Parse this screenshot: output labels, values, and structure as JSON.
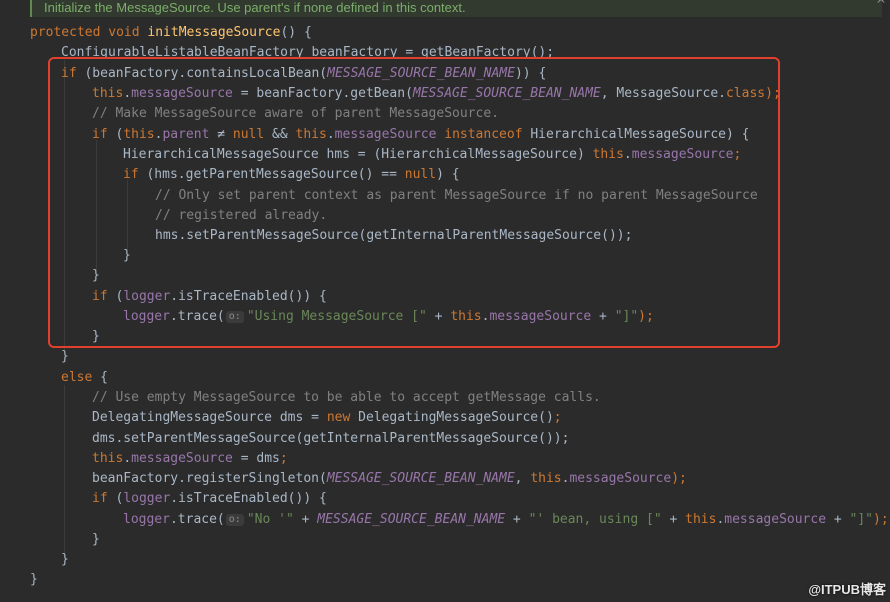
{
  "doc_comment": "Initialize the MessageSource. Use parent's if none defined in this context.",
  "corner_glyph": "^",
  "code": {
    "l1_kw": "protected void ",
    "l1_fn": "initMessageSource",
    "l1_rest": "() {",
    "l2": "ConfigurableListableBeanFactory beanFactory = getBeanFactory();",
    "l3_kw": "if ",
    "l3_a": "(beanFactory.containsLocalBean(",
    "l3_c": "MESSAGE_SOURCE_BEAN_NAME",
    "l3_b": ")) {",
    "l4_this": "this",
    "l4_dot": ".",
    "l4_fld": "messageSource",
    "l4_a": " = beanFactory.getBean(",
    "l4_c": "MESSAGE_SOURCE_BEAN_NAME",
    "l4_b": ", MessageSource.",
    "l4_cls": "class",
    "l4_end": ");",
    "l5": "// Make MessageSource aware of parent MessageSource.",
    "l6_if": "if ",
    "l6_a": "(",
    "l6_this": "this",
    "l6_dot": ".",
    "l6_fld": "parent",
    "l6_b": " ≠ ",
    "l6_null": "null",
    "l6_c": " && ",
    "l6_this2": "this",
    "l6_dot2": ".",
    "l6_fld2": "messageSource",
    "l6_inst": " instanceof ",
    "l6_d": "HierarchicalMessageSource) {",
    "l7_a": "HierarchicalMessageSource hms = (HierarchicalMessageSource) ",
    "l7_this": "this",
    "l7_dot": ".",
    "l7_fld": "messageSource",
    "l7_end": ";",
    "l8_if": "if ",
    "l8_a": "(hms.getParentMessageSource() == ",
    "l8_null": "null",
    "l8_b": ") {",
    "l9": "// Only set parent context as parent MessageSource if no parent MessageSource",
    "l10": "// registered already.",
    "l11": "hms.setParentMessageSource(getInternalParentMessageSource());",
    "l12": "}",
    "l13": "}",
    "l14_if": "if ",
    "l14_a": "(",
    "l14_fld": "logger",
    "l14_b": ".isTraceEnabled()) {",
    "l15_fld": "logger",
    "l15_a": ".trace(",
    "l15_hint": "o:",
    "l15_str": "\"Using MessageSource [\"",
    "l15_b": " + ",
    "l15_this": "this",
    "l15_dot": ".",
    "l15_fld2": "messageSource",
    "l15_c": " + ",
    "l15_str2": "\"]\"",
    "l15_end": ");",
    "l16": "}",
    "l17": "}",
    "l18_kw": "else ",
    "l18_b": "{",
    "l19": "// Use empty MessageSource to be able to accept getMessage calls.",
    "l20_a": "DelegatingMessageSource dms = ",
    "l20_new": "new ",
    "l20_b": "DelegatingMessageSource()",
    "l20_end": ";",
    "l21": "dms.setParentMessageSource(getInternalParentMessageSource());",
    "l22_this": "this",
    "l22_dot": ".",
    "l22_fld": "messageSource",
    "l22_a": " = dms",
    "l22_end": ";",
    "l23_a": "beanFactory.registerSingleton(",
    "l23_c": "MESSAGE_SOURCE_BEAN_NAME",
    "l23_b": ", ",
    "l23_this": "this",
    "l23_dot": ".",
    "l23_fld": "messageSource",
    "l23_end": ");",
    "l24_if": "if ",
    "l24_a": "(",
    "l24_fld": "logger",
    "l24_b": ".isTraceEnabled()) {",
    "l25_fld": "logger",
    "l25_a": ".trace(",
    "l25_hint": "o:",
    "l25_str": "\"No '\"",
    "l25_b": " + ",
    "l25_c": "MESSAGE_SOURCE_BEAN_NAME",
    "l25_d": " + ",
    "l25_str2": "\"' bean, using [\"",
    "l25_e": " + ",
    "l25_this": "this",
    "l25_dot": ".",
    "l25_fld2": "messageSource",
    "l25_f": " + ",
    "l25_str3": "\"]\"",
    "l25_end": ");",
    "l26": "}",
    "l27": "}",
    "l28": "}"
  },
  "watermark": "@ITPUB博客",
  "colors": {
    "background": "#2b2b2b",
    "keyword": "#cc7832",
    "method": "#ffc66d",
    "field": "#9876aa",
    "string": "#6a8759",
    "comment": "#808080",
    "default_text": "#a9b7c6",
    "highlight_border": "#e0402c",
    "doc_text": "#7cad6a"
  }
}
